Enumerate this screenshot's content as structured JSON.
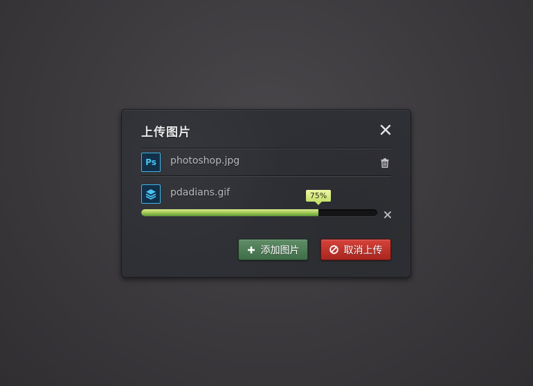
{
  "dialog": {
    "title": "上传图片",
    "close_icon": "close-icon"
  },
  "files": [
    {
      "name": "photoshop.jpg",
      "icon": "photoshop-icon",
      "icon_text": "Ps",
      "action_icon": "trash-icon"
    },
    {
      "name": "pdadians.gif",
      "icon": "layers-icon",
      "progress": 0.75,
      "progress_label": "75%",
      "action_icon": "cancel-x-icon"
    }
  ],
  "buttons": {
    "add_label": "添加图片",
    "add_icon": "plus-icon",
    "cancel_label": "取消上传",
    "cancel_icon": "prohibited-icon"
  },
  "colors": {
    "accent_blue": "#3fb6e8",
    "progress_green": "#a8cc5a",
    "add_button": "#4c7a55",
    "cancel_button": "#c0332c"
  }
}
